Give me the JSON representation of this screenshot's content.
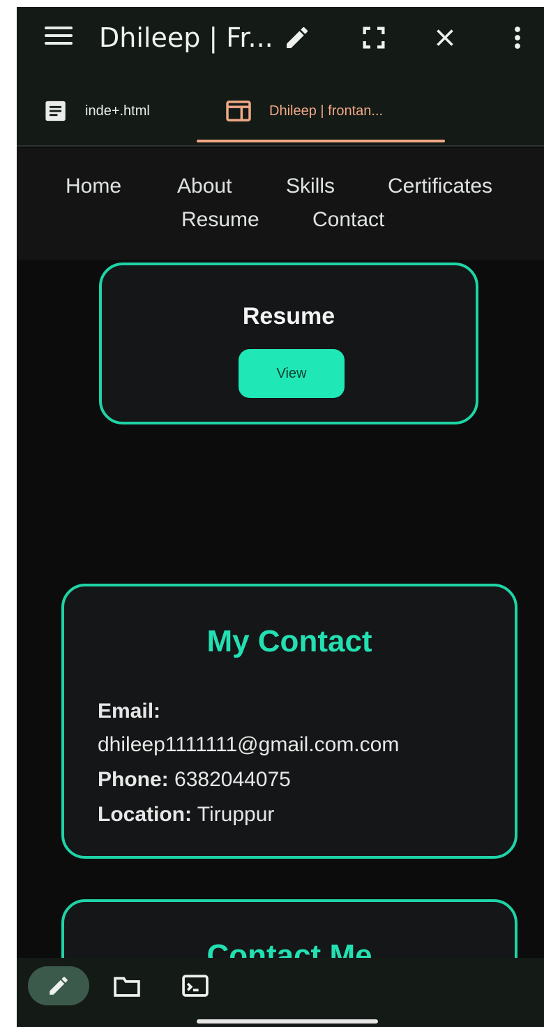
{
  "appbar": {
    "title": "Dhileep | Fr..."
  },
  "tabs": [
    {
      "label": "inde+.html",
      "active": false
    },
    {
      "label": "Dhileep | frontan...",
      "active": true
    }
  ],
  "nav": {
    "items": [
      "Home",
      "About",
      "Skills",
      "Certificates",
      "Resume",
      "Contact"
    ]
  },
  "resume": {
    "title": "Resume",
    "view_label": "View"
  },
  "contact": {
    "heading": "My Contact",
    "email_label": "Email:",
    "email_value": "dhileep1111111@gmail.com.com",
    "phone_label": "Phone:",
    "phone_value": "6382044075",
    "location_label": "Location:",
    "location_value": "Tiruppur"
  },
  "contact_me": {
    "heading": "Contact Me"
  },
  "colors": {
    "accent": "#1ed4a7",
    "button": "#1fe8b6",
    "tab_active": "#f0a987",
    "background": "#0b0c0b"
  },
  "icons": [
    "menu-icon",
    "pencil-icon",
    "fullscreen-icon",
    "close-icon",
    "more-vert-icon",
    "document-icon",
    "browser-icon",
    "folder-icon",
    "terminal-icon"
  ]
}
